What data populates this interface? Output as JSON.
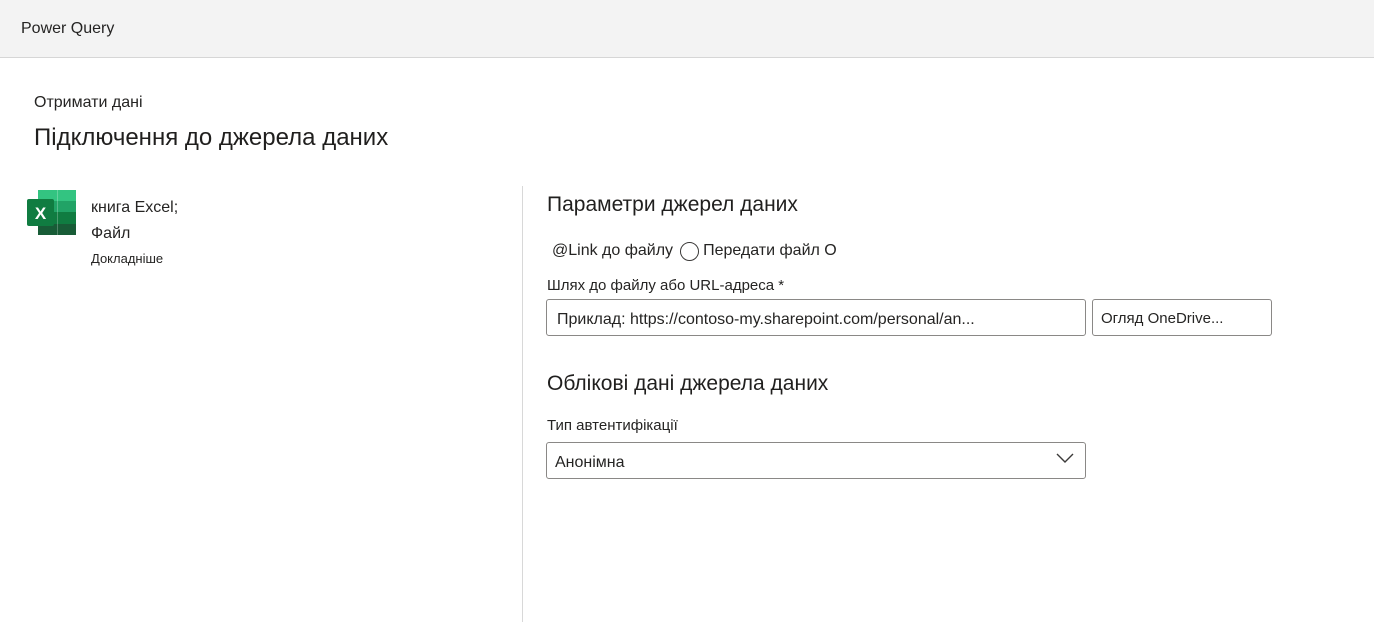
{
  "app": {
    "title": "Power Query"
  },
  "header": {
    "breadcrumb": "Отримати дані",
    "title": "Підключення до джерела даних"
  },
  "connector": {
    "icon": "excel-icon",
    "name_line1": "книга Excel;",
    "name_line2": "Файл",
    "learn_more": "Докладніше"
  },
  "settings": {
    "title": "Параметри джерел даних",
    "link_option": "@Link до файлу",
    "upload_option": "Передати файл О",
    "path_label": "Шлях до файлу або URL-адреса *",
    "path_value": "Приклад: https://contoso-my.sharepoint.com/personal/an...",
    "browse_label": "Огляд OneDrive..."
  },
  "credentials": {
    "title": "Облікові дані джерела даних",
    "auth_label": "Тип автентифікації",
    "auth_value": "Анонімна"
  },
  "colors": {
    "excel_dark": "#185c37",
    "excel_mid": "#107c41",
    "excel_light": "#21a366",
    "excel_lightest": "#33c481"
  }
}
